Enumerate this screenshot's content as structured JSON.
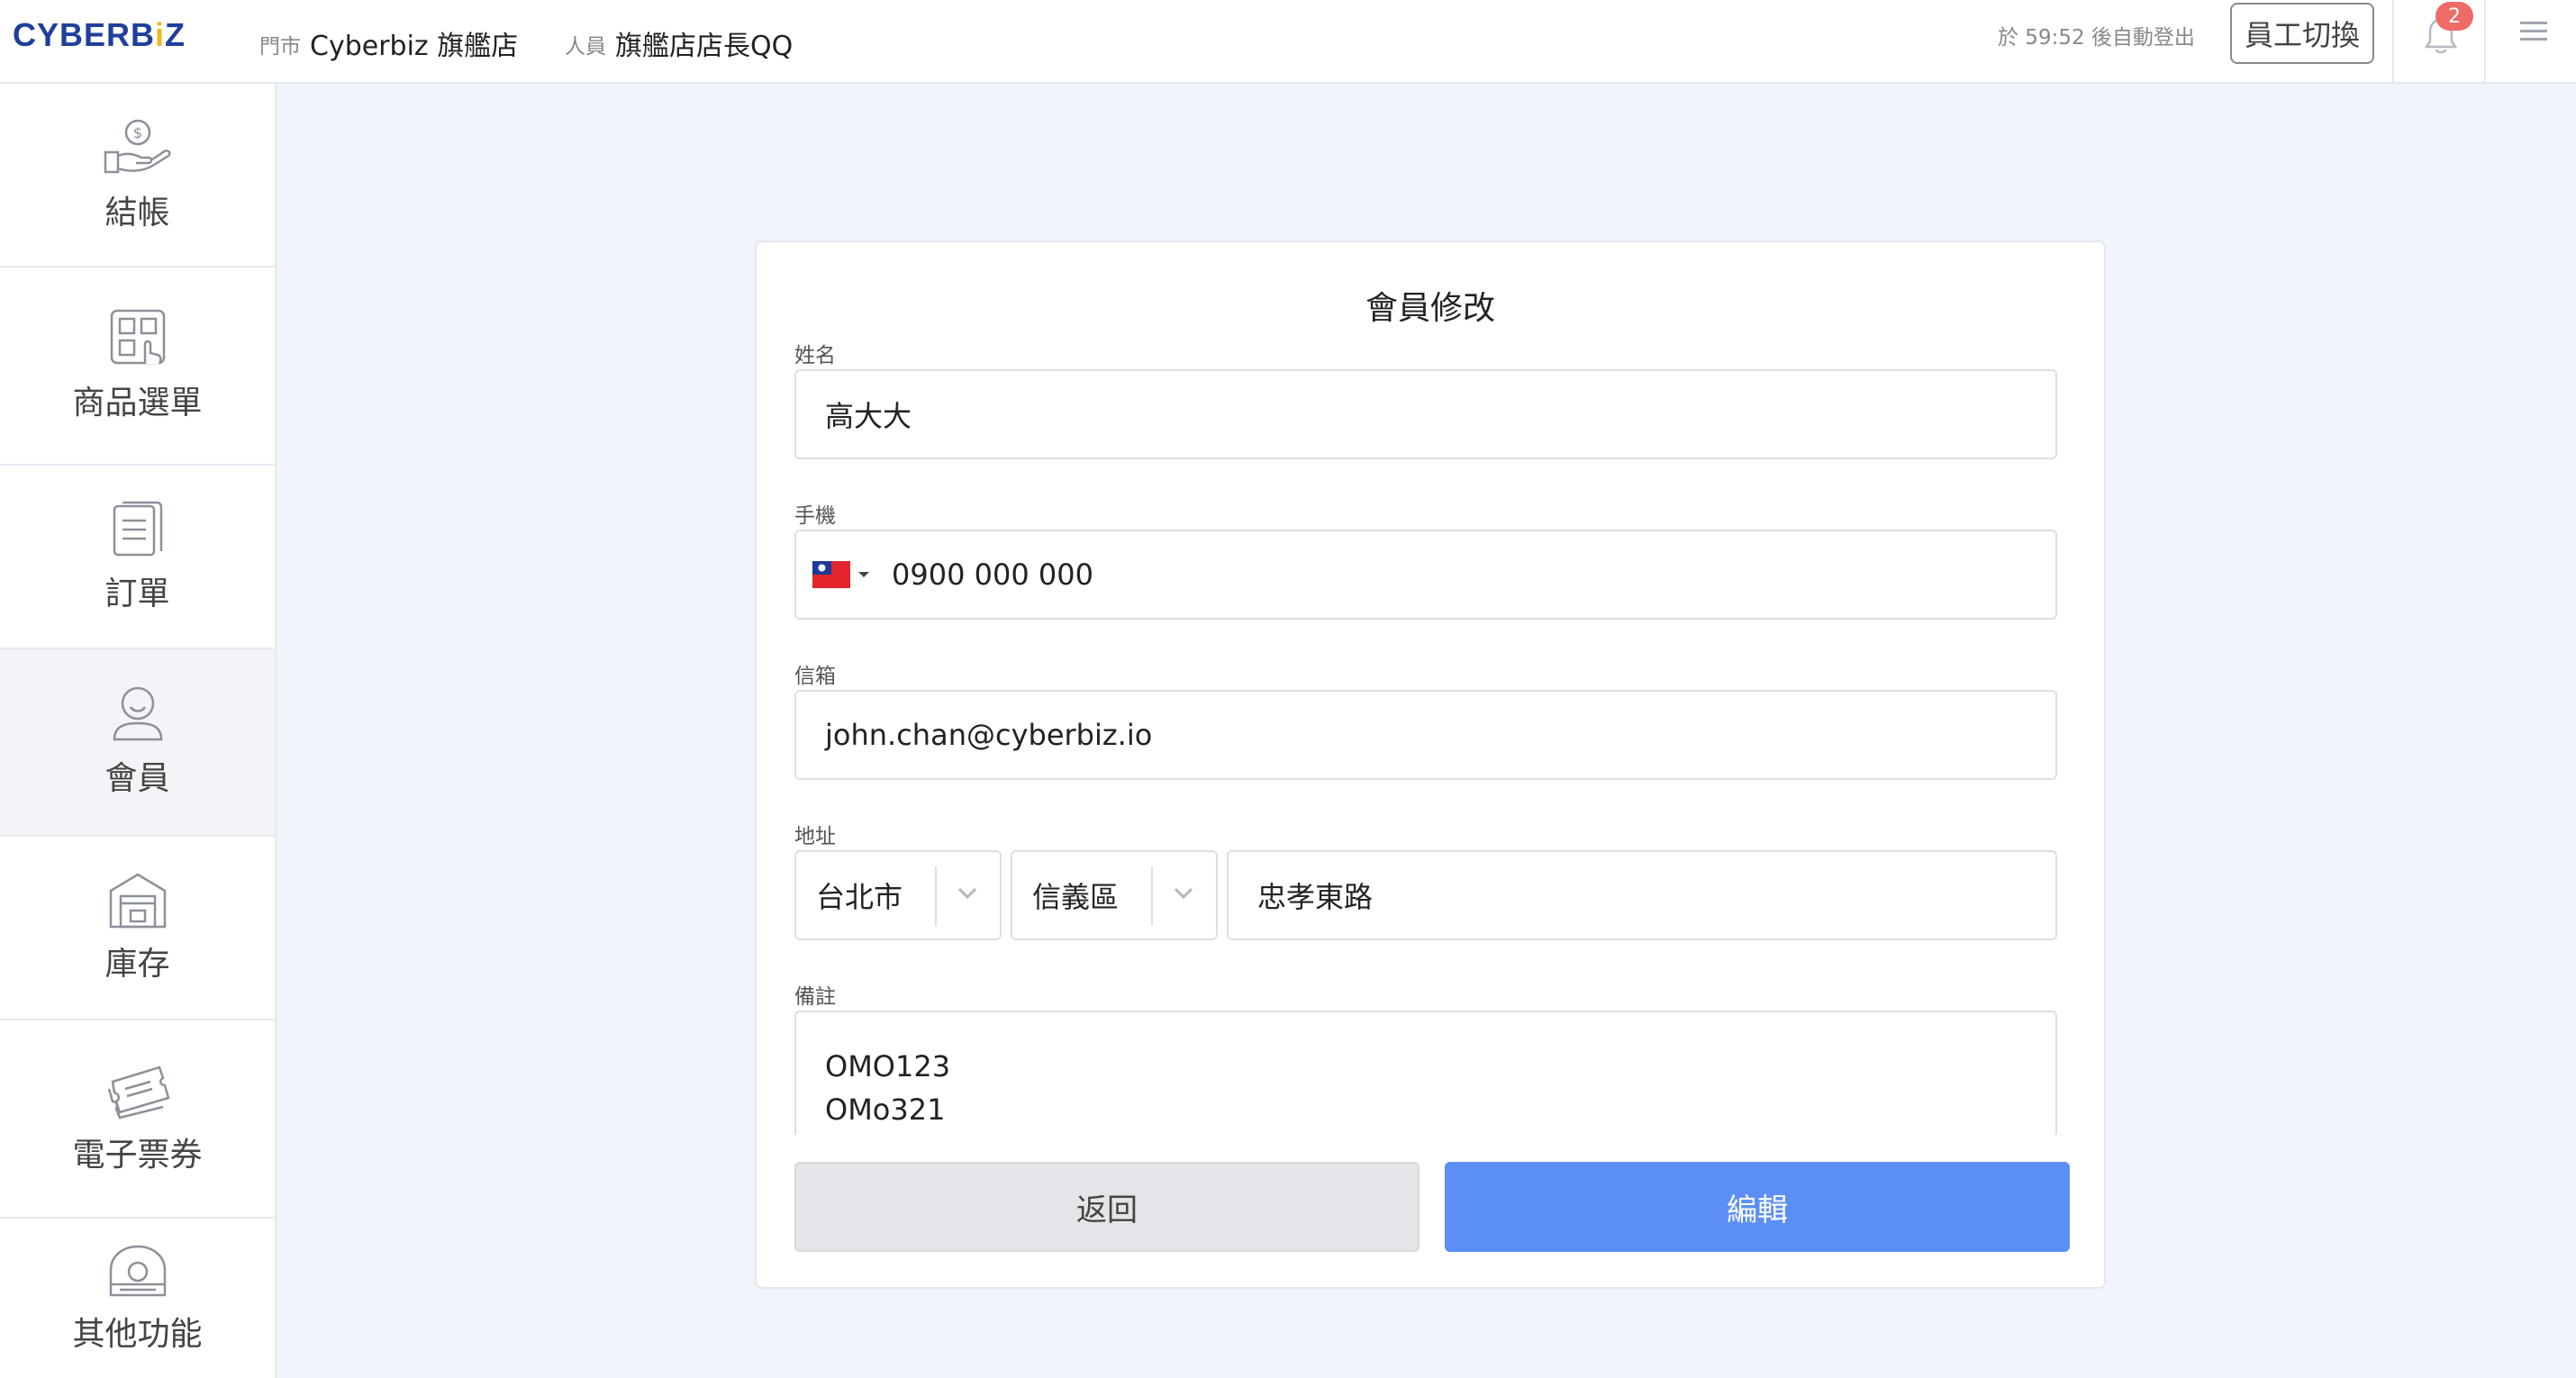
{
  "header": {
    "logo_text": "CYBERB",
    "logo_dot": "i",
    "logo_end": "Z",
    "store_label": "門市",
    "store_name": "Cyberbiz 旗艦店",
    "staff_label": "人員",
    "staff_name": "旗艦店店長QQ",
    "logout_timer": "於 59:52 後自動登出",
    "switch_staff_label": "員工切換",
    "notification_count": "2"
  },
  "sidebar": {
    "items": [
      {
        "label": "結帳",
        "icon": "checkout-icon"
      },
      {
        "label": "商品選單",
        "icon": "product-menu-icon"
      },
      {
        "label": "訂單",
        "icon": "order-icon"
      },
      {
        "label": "會員",
        "icon": "member-icon",
        "active": true
      },
      {
        "label": "庫存",
        "icon": "warehouse-icon"
      },
      {
        "label": "電子票券",
        "icon": "ticket-icon"
      },
      {
        "label": "其他功能",
        "icon": "other-functions-icon"
      }
    ]
  },
  "form": {
    "title": "會員修改",
    "name_label": "姓名",
    "name_value": "高大大",
    "phone_label": "手機",
    "phone_value": "0900 000 000",
    "email_label": "信箱",
    "email_value": "john.chan@cyberbiz.io",
    "address_label": "地址",
    "city_value": "台北市",
    "district_value": "信義區",
    "street_value": "忠孝東路",
    "note_label": "備註",
    "note_line1": "OMO123",
    "note_line2": "OMo321",
    "back_label": "返回",
    "edit_label": "編輯"
  },
  "colors": {
    "brand": "#1f3f9c",
    "primary_button": "#5b8ff6",
    "badge": "#ee6b66",
    "background": "#f0f4fb"
  }
}
